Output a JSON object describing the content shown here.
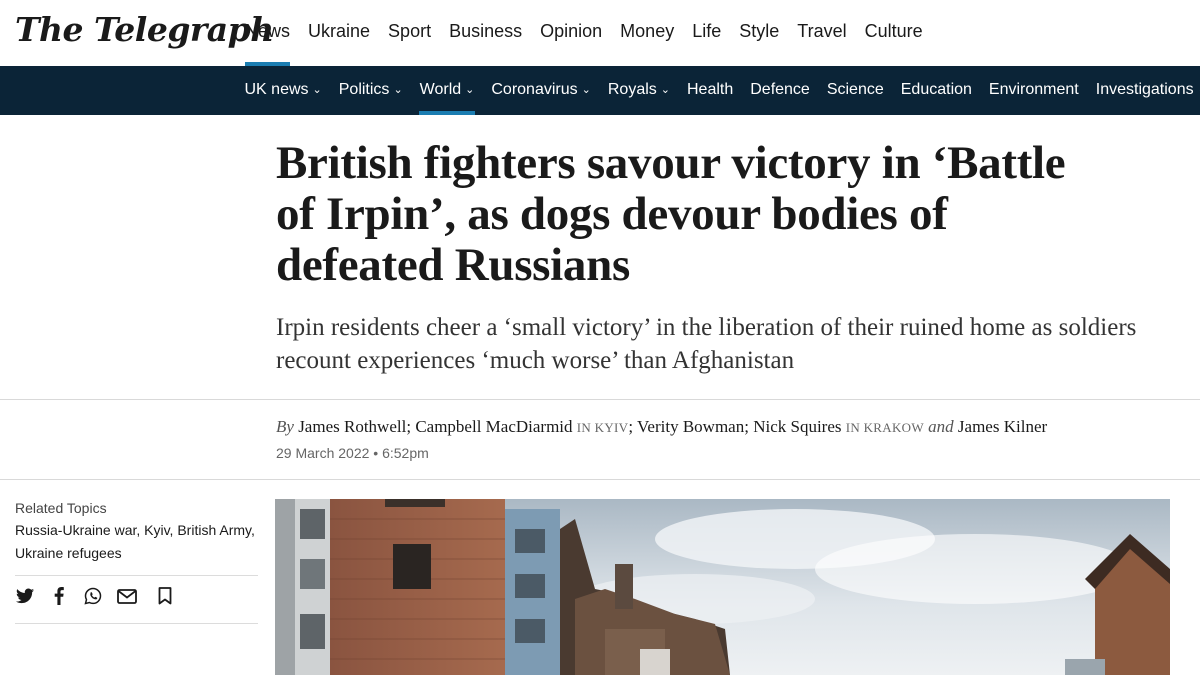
{
  "header": {
    "logo": "The Telegraph",
    "nav": [
      "News",
      "Ukraine",
      "Sport",
      "Business",
      "Opinion",
      "Money",
      "Life",
      "Style",
      "Travel",
      "Culture"
    ],
    "active_nav": "News"
  },
  "subnav": {
    "items": [
      {
        "label": "UK news",
        "dropdown": true
      },
      {
        "label": "Politics",
        "dropdown": true
      },
      {
        "label": "World",
        "dropdown": true,
        "active": true
      },
      {
        "label": "Coronavirus",
        "dropdown": true
      },
      {
        "label": "Royals",
        "dropdown": true
      },
      {
        "label": "Health",
        "dropdown": false
      },
      {
        "label": "Defence",
        "dropdown": false
      },
      {
        "label": "Science",
        "dropdown": false
      },
      {
        "label": "Education",
        "dropdown": false
      },
      {
        "label": "Environment",
        "dropdown": false
      },
      {
        "label": "Investigations",
        "dropdown": true
      }
    ]
  },
  "article": {
    "headline": "British fighters savour victory in ‘Battle of Irpin’, as dogs devour bodies of defeated Russians",
    "standfirst": "Irpin residents cheer a ‘small victory’ in the liberation of their ruined home as soldiers recount experiences ‘much worse’ than Afghanistan",
    "byline": {
      "by": "By",
      "author1": "James Rothwell",
      "author2": "Campbell MacDiarmid",
      "loc2": "IN KYIV",
      "author3": "Verity Bowman",
      "author4": "Nick Squires",
      "loc4": "IN KRAKOW",
      "and": "and",
      "author5": "James Kilner"
    },
    "date": "29 March 2022 • 6:52pm"
  },
  "sidebar": {
    "related_label": "Related Topics",
    "related_line1": "Russia-Ukraine war, Kyiv, British Army,",
    "related_line2": "Ukraine refugees",
    "share_icons": [
      "twitter-icon",
      "facebook-icon",
      "whatsapp-icon",
      "email-icon",
      "bookmark-icon"
    ]
  },
  "colors": {
    "subnav_bg": "#0b2437",
    "accent": "#1b7db1"
  }
}
